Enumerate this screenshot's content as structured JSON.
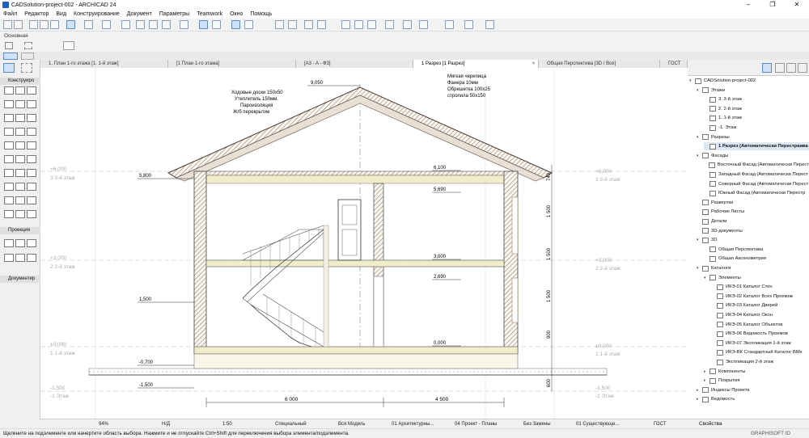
{
  "window": {
    "title": "CADSolution-project-002 - ARCHICAD 24",
    "minimize": "–",
    "maximize": "❐",
    "close": "✕"
  },
  "menu": [
    "Файл",
    "Редактор",
    "Вид",
    "Конструирование",
    "Документ",
    "Параметры",
    "Teamwork",
    "Окно",
    "Помощь"
  ],
  "info_box": {
    "label": "Основная"
  },
  "tabs": [
    {
      "label": "1. План 1-го этажа [1. 1-й этаж]",
      "active": false
    },
    {
      "label": "[1 План 1-го этажа]",
      "active": false
    },
    {
      "label": "[A3 - A - Ф3]",
      "active": false
    },
    {
      "label": "1 Разрез [1 Разрез]",
      "active": true
    },
    {
      "label": "Общая Перспектива [3D / Все]",
      "active": false
    },
    {
      "label": "ГОСТ",
      "active": false
    }
  ],
  "toolbox": {
    "sections": [
      "Конструиро",
      "Проекция",
      "Документир"
    ]
  },
  "drawing": {
    "level_marks_left": [
      {
        "v": "+6,000",
        "n": "3 3-й этаж"
      },
      {
        "v": "+3,000",
        "n": "2 2-й этаж"
      },
      {
        "v": "±0,000",
        "n": "1 1-й этаж"
      },
      {
        "v": "-1,500",
        "n": "-1 Этаж"
      }
    ],
    "level_marks_right": [
      {
        "v": "+6,000",
        "n": "3 3-й этаж"
      },
      {
        "v": "+3,000",
        "n": "2 2-й этаж"
      },
      {
        "v": "±0,000",
        "n": "1 1-й этаж"
      },
      {
        "v": "-1,500",
        "n": "-1 Этаж"
      }
    ],
    "note_left": [
      "Ходовые доски 150х50",
      "Утеплитель 150мм.",
      "Пароизоляция",
      "Ж/б перекрытие"
    ],
    "note_right": [
      "Мягкая черепица",
      "Фанера 10мм",
      "Обрешетка 100х25",
      "стропила 50х150"
    ],
    "elevations": {
      "ridge": "9,050",
      "eave": "5,800",
      "left_mid": "1,500",
      "ground": "-0,700",
      "bottom": "-1,500",
      "top_floor": "6,100",
      "ceiling2": "5,690",
      "floor2": "3,000",
      "ceiling1": "2,690",
      "floor1": "0,000"
    },
    "dims_bottom": [
      "6 000",
      "4 500"
    ],
    "dims_right": [
      "740",
      "1 500",
      "1 500",
      "1 500",
      "900",
      "600"
    ]
  },
  "navigator": {
    "items": [
      {
        "t": "CADSolution-project-002",
        "lvl": 0,
        "arrow": "v"
      },
      {
        "t": "Этажи",
        "lvl": 1,
        "arrow": "v"
      },
      {
        "t": "3. 3-й этаж",
        "lvl": 2
      },
      {
        "t": "2. 2-й этаж",
        "lvl": 2
      },
      {
        "t": "1. 1-й этаж",
        "lvl": 2
      },
      {
        "t": "-1. Этаж",
        "lvl": 2
      },
      {
        "t": "Разрезы",
        "lvl": 1,
        "arrow": "v"
      },
      {
        "t": "1 Разрез (Автоматически Перестраива",
        "lvl": 2,
        "sel": true
      },
      {
        "t": "Фасады",
        "lvl": 1,
        "arrow": "v"
      },
      {
        "t": "Восточный Фасад (Автоматически Перест",
        "lvl": 2
      },
      {
        "t": "Западный Фасад (Автоматически Перест",
        "lvl": 2
      },
      {
        "t": "Северный Фасад (Автоматически Перест",
        "lvl": 2
      },
      {
        "t": "Южный Фасад (Автоматически Перестр",
        "lvl": 2
      },
      {
        "t": "Развертки",
        "lvl": 1
      },
      {
        "t": "Рабочие Листы",
        "lvl": 1
      },
      {
        "t": "Детали",
        "lvl": 1
      },
      {
        "t": "3D-документы",
        "lvl": 1
      },
      {
        "t": "3D",
        "lvl": 1,
        "arrow": "v"
      },
      {
        "t": "Общая Перспектива",
        "lvl": 2
      },
      {
        "t": "Общая Аксонометрия",
        "lvl": 2
      },
      {
        "t": "Каталоги",
        "lvl": 1,
        "arrow": "v"
      },
      {
        "t": "Элементы",
        "lvl": 2,
        "arrow": "v"
      },
      {
        "t": "ИКЭ-01 Каталог Стен",
        "lvl": 3
      },
      {
        "t": "ИКЭ-02 Каталог Всех Проемов",
        "lvl": 3
      },
      {
        "t": "ИКЭ-03 Каталог Дверей",
        "lvl": 3
      },
      {
        "t": "ИКЭ-04 Каталог Окон",
        "lvl": 3
      },
      {
        "t": "ИКЭ-05 Каталог Объектов",
        "lvl": 3
      },
      {
        "t": "ИКЭ-06 Ведомость Проемов",
        "lvl": 3
      },
      {
        "t": "ИКЭ-07 Экспликация 1-й этаж",
        "lvl": 3
      },
      {
        "t": "ИКЭ-ВК Стандартный Каталог ВМх",
        "lvl": 3
      },
      {
        "t": "Экспликация 2-й этаж",
        "lvl": 3
      },
      {
        "t": "Компоненты",
        "lvl": 2,
        "arrow": ">"
      },
      {
        "t": "Покрытия",
        "lvl": 2,
        "arrow": ">"
      },
      {
        "t": "Индексы Проекта",
        "lvl": 1,
        "arrow": ">"
      },
      {
        "t": "Ведомость",
        "lvl": 1,
        "arrow": ">"
      }
    ],
    "properties_label": "Свойства"
  },
  "status": {
    "zoom": "94%",
    "nd": "Н/Д",
    "scale": "1:50",
    "layer": "Специальный",
    "model": "Вся Модель",
    "arch": "01 Архитектурны...",
    "plan": "04 Проект - Планы",
    "replace": "Без Замены",
    "existing": "01 Существующе...",
    "gost": "ГОСТ"
  },
  "footer": {
    "hint": "Щелкните на подэлементе или начертите область выбора. Нажмите и не отпускайте Ctrl+Shift для переключения выбора элемента/подэлемента.",
    "brand": "GRAPHISOFT ID"
  },
  "colors": {
    "wall": "#6b5a4c",
    "slab": "#f1ecc9",
    "roof": "#5a4438",
    "accent": "#1e6fd4"
  }
}
